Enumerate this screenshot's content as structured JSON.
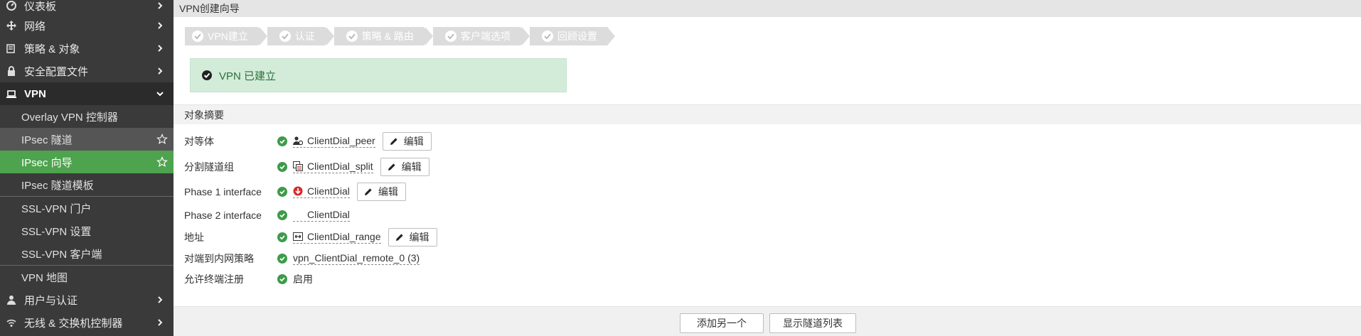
{
  "sidebar": {
    "items": [
      {
        "label": "仪表板",
        "icon": "dashboard-icon"
      },
      {
        "label": "网络",
        "icon": "network-icon"
      },
      {
        "label": "策略 & 对象",
        "icon": "policy-icon"
      },
      {
        "label": "安全配置文件",
        "icon": "lock-icon"
      },
      {
        "label": "VPN",
        "icon": "laptop-icon"
      },
      {
        "label": "Overlay VPN 控制器"
      },
      {
        "label": "IPsec 隧道"
      },
      {
        "label": "IPsec 向导"
      },
      {
        "label": "IPsec 隧道模板"
      },
      {
        "label": "SSL-VPN 门户"
      },
      {
        "label": "SSL-VPN 设置"
      },
      {
        "label": "SSL-VPN 客户端"
      },
      {
        "label": "VPN 地图"
      },
      {
        "label": "用户与认证",
        "icon": "user-icon"
      },
      {
        "label": "无线 & 交换机控制器",
        "icon": "wifi-icon"
      }
    ]
  },
  "main": {
    "title": "VPN创建向导",
    "steps": [
      "VPN建立",
      "认证",
      "策略 & 路由",
      "客户端选项",
      "回顾设置"
    ],
    "success_message": "VPN 已建立",
    "summary_title": "对象摘要",
    "rows": [
      {
        "label": "对等体",
        "value": "ClientDial_peer",
        "icon": "peer-user-icon",
        "has_edit": true
      },
      {
        "label": "分割隧道组",
        "value": "ClientDial_split",
        "icon": "address-group-icon",
        "has_edit": true
      },
      {
        "label": "Phase 1 interface",
        "value": "ClientDial",
        "icon": "interface-down-icon",
        "has_edit": true
      },
      {
        "label": "Phase 2 interface",
        "value": "ClientDial",
        "icon": "",
        "has_edit": false
      },
      {
        "label": "地址",
        "value": "ClientDial_range",
        "icon": "address-range-icon",
        "has_edit": true
      },
      {
        "label": "对端到内网策略",
        "value": "vpn_ClientDial_remote_0 (3)",
        "icon": "",
        "has_edit": false
      },
      {
        "label": "允许终端注册",
        "value": "启用",
        "icon": "",
        "has_edit": false
      }
    ],
    "edit_label": "编辑"
  },
  "footer": {
    "add_another": "添加另一个",
    "show_tunnels": "显示隧道列表"
  },
  "colors": {
    "sidebar_bg": "#3a3a3a",
    "active_green": "#4ea34e",
    "success_bg": "#d3ecd9",
    "check_green": "#3d9b4a"
  }
}
